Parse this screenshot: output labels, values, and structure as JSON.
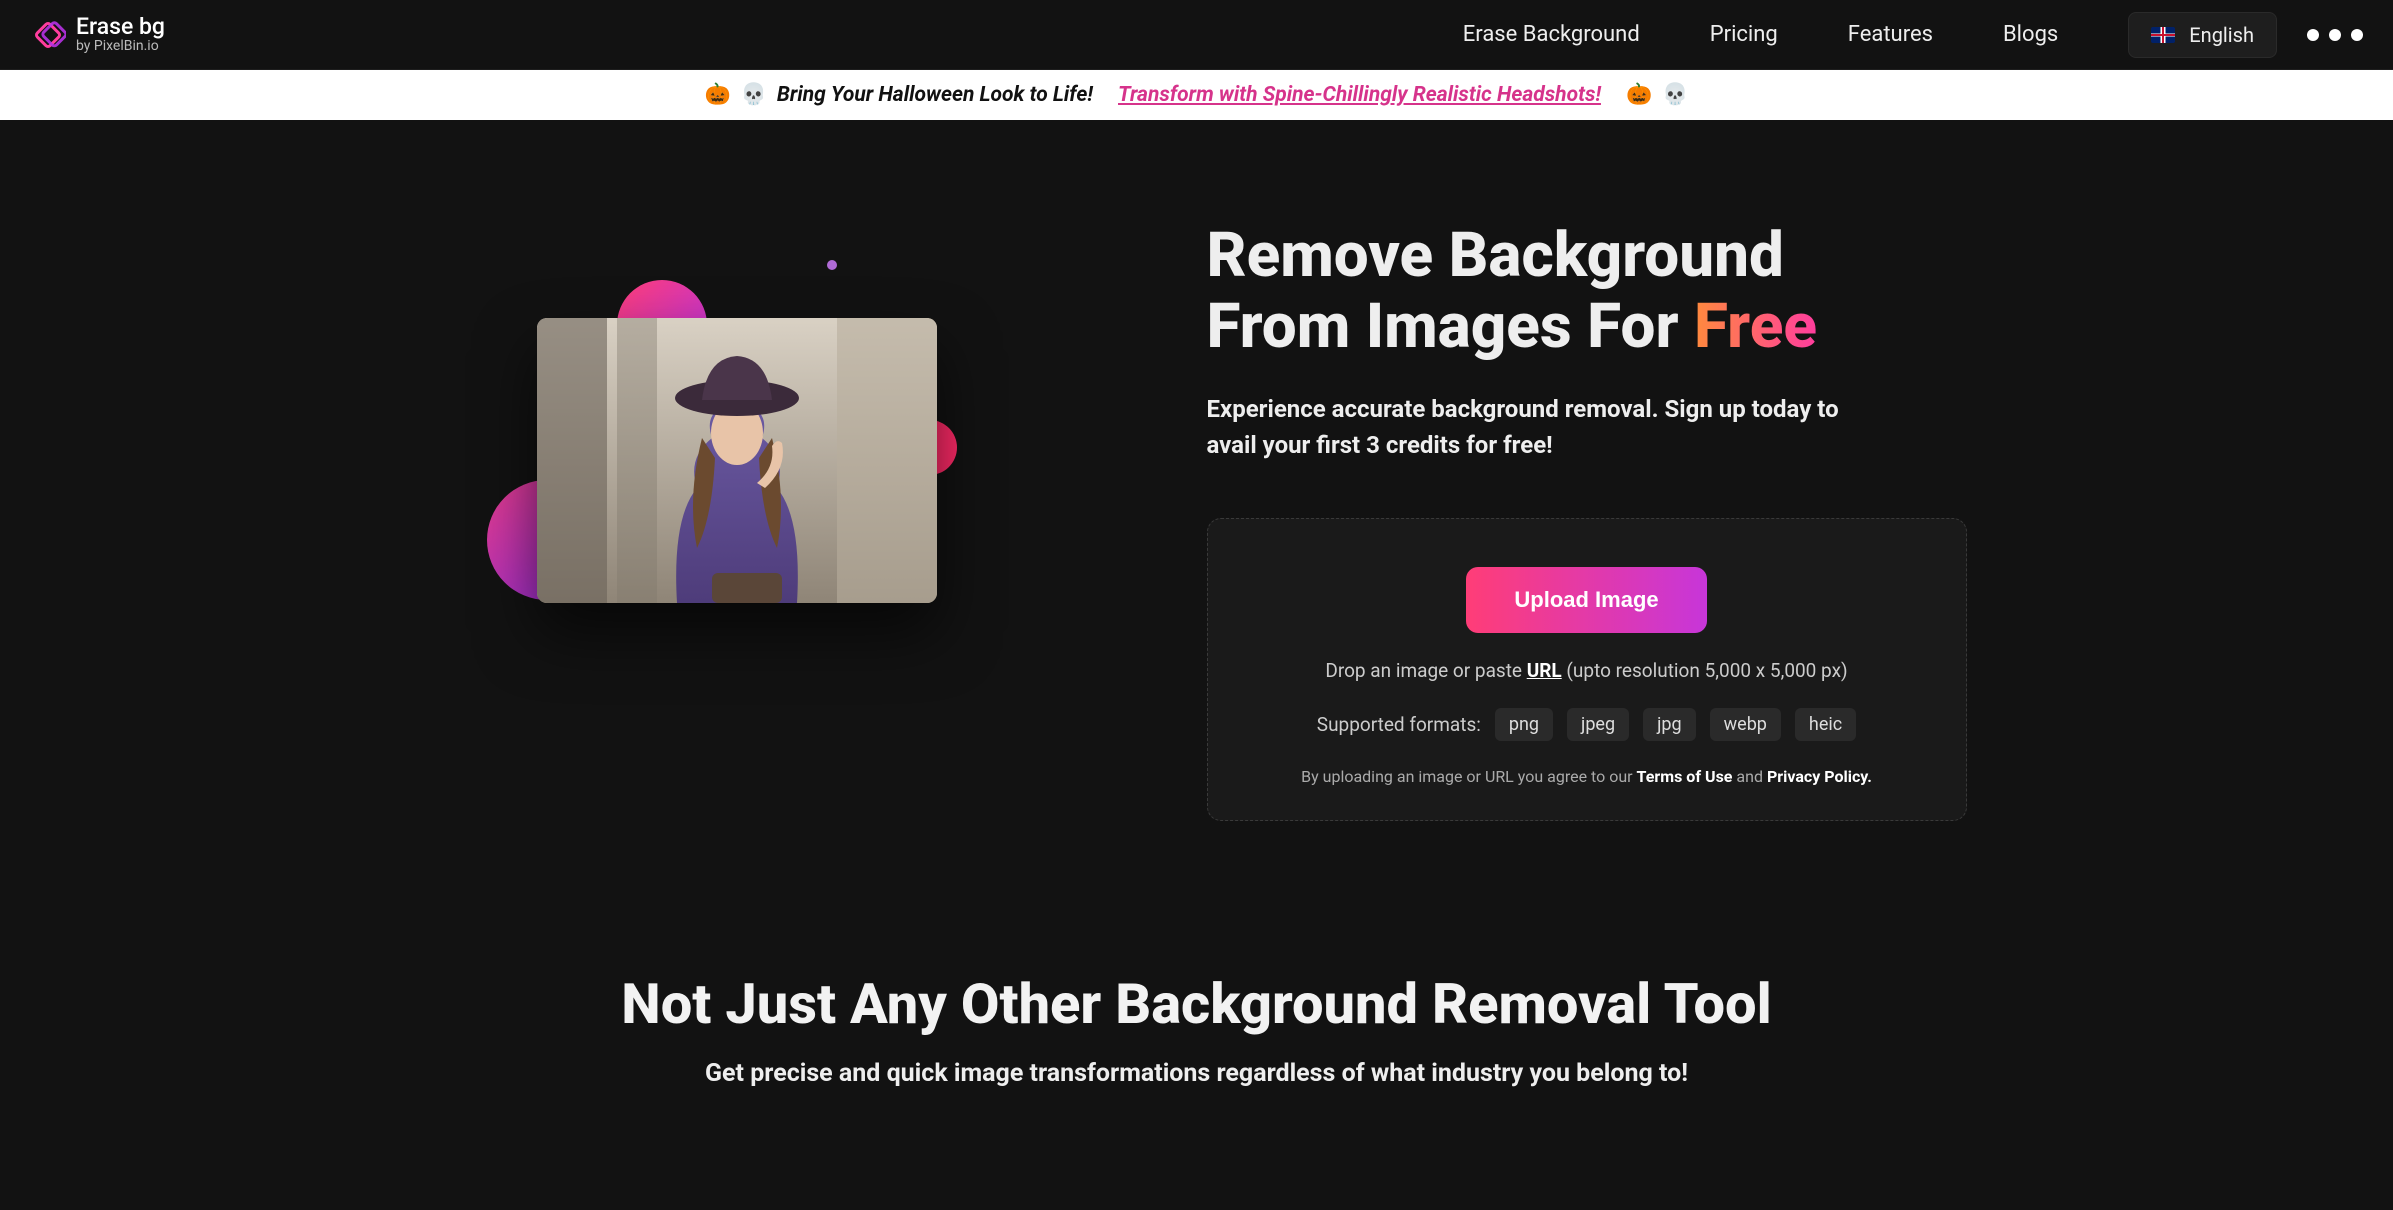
{
  "header": {
    "logo_title": "Erase bg",
    "logo_sub": "by PixelBin.io",
    "nav": {
      "erase": "Erase Background",
      "pricing": "Pricing",
      "features": "Features",
      "blogs": "Blogs"
    },
    "language": "English"
  },
  "promo": {
    "lead_emoji_1": "🎃",
    "lead_emoji_2": "💀",
    "text": "Bring Your Halloween Look to Life!",
    "link": "Transform with Spine-Chillingly Realistic Headshots!",
    "trail_emoji_1": "🎃",
    "trail_emoji_2": "💀"
  },
  "hero": {
    "title_line1": "Remove Background",
    "title_line2_a": "From Images For ",
    "title_line2_b": "Free",
    "subtitle": "Experience accurate background removal. Sign up today to avail your first 3 credits for free!",
    "upload_button": "Upload Image",
    "drop_prefix": "Drop an image or paste ",
    "drop_url": "URL",
    "drop_suffix": " (upto resolution 5,000 x 5,000 px)",
    "formats_label": "Supported formats:",
    "formats": [
      "png",
      "jpeg",
      "jpg",
      "webp",
      "heic"
    ],
    "terms_prefix": "By uploading an image or URL you agree to our ",
    "terms_of_use": "Terms of Use",
    "terms_and": " and ",
    "privacy_policy": "Privacy Policy."
  },
  "section2": {
    "heading": "Not Just Any Other Background Removal Tool",
    "sub": "Get precise and quick image transformations regardless of what industry you belong to!"
  }
}
